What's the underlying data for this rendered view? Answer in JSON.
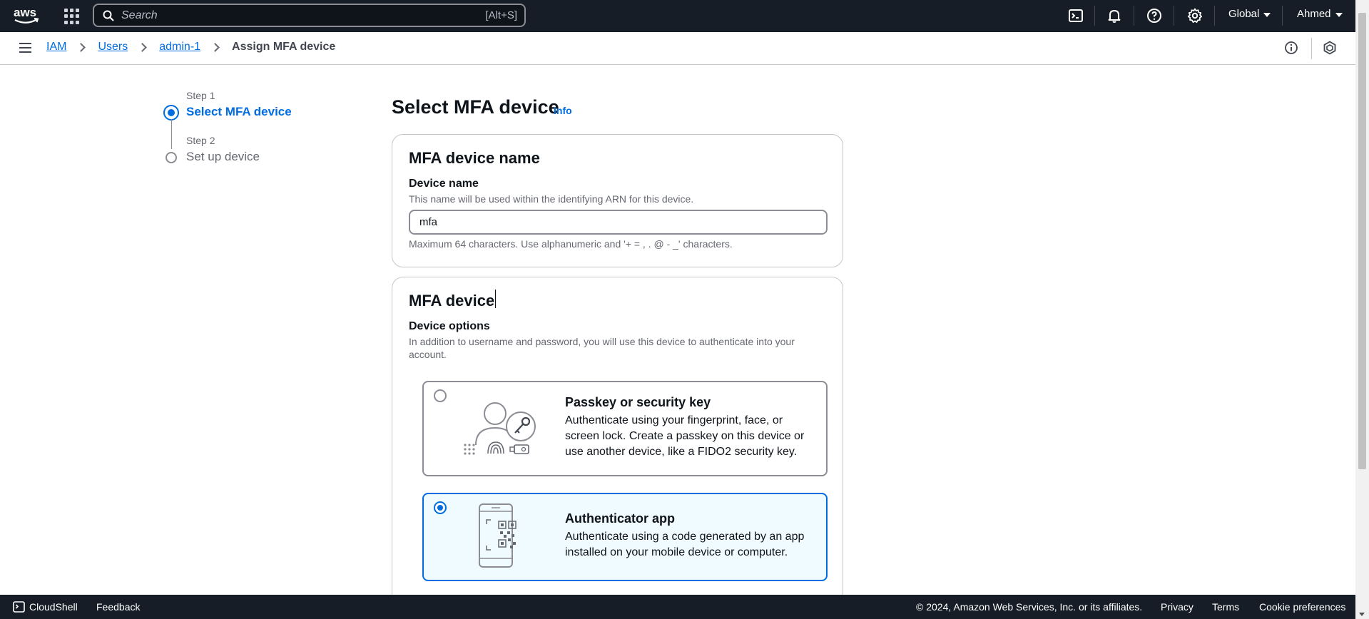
{
  "topnav": {
    "logo": "aws",
    "search_placeholder": "Search",
    "search_shortcut": "[Alt+S]",
    "region": "Global",
    "user": "Ahmed"
  },
  "breadcrumb": {
    "items": [
      "IAM",
      "Users",
      "admin-1"
    ],
    "current": "Assign MFA device"
  },
  "wizard": {
    "steps": [
      {
        "label": "Step 1",
        "title": "Select MFA device",
        "state": "active"
      },
      {
        "label": "Step 2",
        "title": "Set up device",
        "state": "pending"
      }
    ]
  },
  "main": {
    "title": "Select MFA device",
    "info_link": "Info",
    "name_section": {
      "title": "MFA device name",
      "field_label": "Device name",
      "field_description": "This name will be used within the identifying ARN for this device.",
      "field_value": "mfa",
      "field_constraint": "Maximum 64 characters. Use alphanumeric and '+ = , . @ - _' characters."
    },
    "device_section": {
      "title": "MFA device",
      "options_label": "Device options",
      "options_description": "In addition to username and password, you will use this device to authenticate into your account.",
      "options": [
        {
          "title": "Passkey or security key",
          "description": "Authenticate using your fingerprint, face, or screen lock. Create a passkey on this device or use another device, like a FIDO2 security key.",
          "selected": false,
          "icon": "passkey-illustration"
        },
        {
          "title": "Authenticator app",
          "description": "Authenticate using a code generated by an app installed on your mobile device or computer.",
          "selected": true,
          "icon": "authenticator-app-illustration"
        }
      ]
    }
  },
  "footer": {
    "cloudshell": "CloudShell",
    "feedback": "Feedback",
    "copyright": "© 2024, Amazon Web Services, Inc. or its affiliates.",
    "privacy": "Privacy",
    "terms": "Terms",
    "cookie_preferences": "Cookie preferences"
  },
  "colors": {
    "nav_background": "#161d26",
    "link_blue": "#006ce0",
    "selected_tile_background": "#f0fbff",
    "border_gray": "#8c8c94"
  }
}
